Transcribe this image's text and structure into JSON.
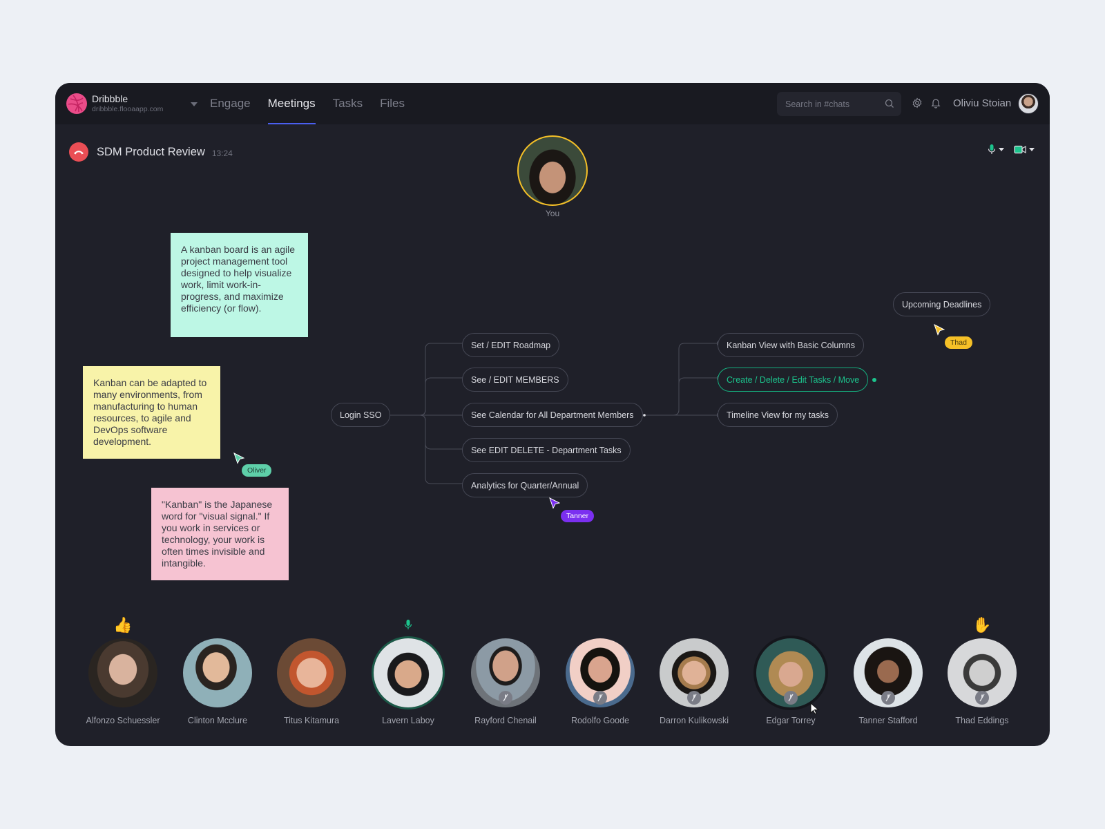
{
  "brand": {
    "name": "Dribbble",
    "url": "dribbble.flooaapp.com",
    "color": "#ea4c89"
  },
  "nav": {
    "tabs": [
      {
        "label": "Engage",
        "active": false
      },
      {
        "label": "Meetings",
        "active": true
      },
      {
        "label": "Tasks",
        "active": false
      },
      {
        "label": "Files",
        "active": false
      }
    ]
  },
  "search": {
    "placeholder": "Search in #chats",
    "value": ""
  },
  "user": {
    "name": "Oliviu Stoian"
  },
  "meeting": {
    "title": "SDM Product Review",
    "time": "13:24",
    "mic_on": true,
    "camera_on": true
  },
  "self": {
    "label": "You"
  },
  "stickies": [
    {
      "color": "#bdf7e5",
      "text": "A kanban board is an agile project management tool designed to help visualize work, limit work-in-progress, and maximize efficiency (or flow)."
    },
    {
      "color": "#f8f3a9",
      "text": "Kanban can be adapted to many environments, from manufacturing to human resources, to agile and DevOps software development."
    },
    {
      "color": "#f6c3d2",
      "text": "\"Kanban\" is the Japanese word for \"visual signal.\" If you work in services or technology, your work is often times invisible and intangible."
    }
  ],
  "mindmap": {
    "root": "Login SSO",
    "level1": [
      "Set / EDIT Roadmap",
      "See / EDIT MEMBERS",
      "See Calendar for All Department Members",
      "See EDIT DELETE - Department Tasks",
      "Analytics for Quarter/Annual"
    ],
    "level2": [
      {
        "label": "Kanban View with Basic Columns",
        "active": false
      },
      {
        "label": "Create / Delete / Edit Tasks / Move",
        "active": true
      },
      {
        "label": "Timeline View for my tasks",
        "active": false
      }
    ],
    "floating": "Upcoming Deadlines"
  },
  "cursors": [
    {
      "name": "Oliver",
      "color": "#5ecfa9"
    },
    {
      "name": "Tanner",
      "color": "#7b2ff0"
    },
    {
      "name": "Thad",
      "color": "#f5c027"
    }
  ],
  "participants": [
    {
      "name": "Alfonzo Schuessler",
      "reaction": "👍",
      "muted": false,
      "speaking": false
    },
    {
      "name": "Clinton Mcclure",
      "reaction": "",
      "muted": false,
      "speaking": false
    },
    {
      "name": "Titus Kitamura",
      "reaction": "",
      "muted": false,
      "speaking": false
    },
    {
      "name": "Lavern Laboy",
      "reaction": "mic",
      "muted": false,
      "speaking": true
    },
    {
      "name": "Rayford Chenail",
      "reaction": "",
      "muted": true,
      "speaking": false
    },
    {
      "name": "Rodolfo Goode",
      "reaction": "",
      "muted": true,
      "speaking": false
    },
    {
      "name": "Darron Kulikowski",
      "reaction": "",
      "muted": true,
      "speaking": false
    },
    {
      "name": "Edgar Torrey",
      "reaction": "",
      "muted": true,
      "speaking": false
    },
    {
      "name": "Tanner Stafford",
      "reaction": "",
      "muted": true,
      "speaking": false
    },
    {
      "name": "Thad Eddings",
      "reaction": "✋",
      "muted": true,
      "speaking": false
    }
  ]
}
